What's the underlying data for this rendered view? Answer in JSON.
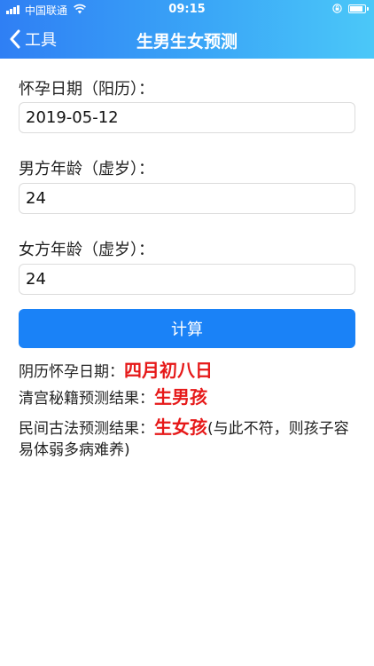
{
  "status_bar": {
    "carrier": "中国联通",
    "time": "09:15"
  },
  "nav": {
    "back_label": "工具",
    "title": "生男生女预测"
  },
  "form": {
    "pregnancy_date_label": "怀孕日期（阳历）：",
    "pregnancy_date_value": "2019-05-12",
    "male_age_label": "男方年龄（虚岁）：",
    "male_age_value": "24",
    "female_age_label": "女方年龄（虚岁）：",
    "female_age_value": "24",
    "calc_button_label": "计算"
  },
  "results": {
    "lunar_date_label": "阴历怀孕日期：",
    "lunar_date_value": "四月初八日",
    "qing_palace_label": "清宫秘籍预测结果：",
    "qing_palace_value": "生男孩",
    "folk_label": "民间古法预测结果：",
    "folk_value": "生女孩",
    "folk_note": "(与此不符，则孩子容易体弱多病难养)"
  },
  "colors": {
    "accent": "#1a82f7",
    "result_red": "#e61919",
    "header_gradient_start": "#2f7ff4",
    "header_gradient_end": "#4bc8f8"
  }
}
